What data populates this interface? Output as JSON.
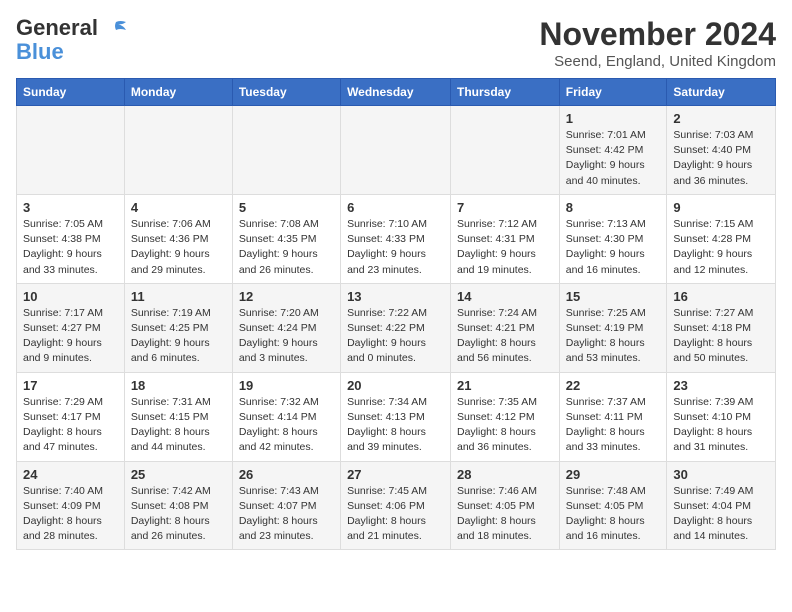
{
  "header": {
    "logo_line1": "General",
    "logo_line2": "Blue",
    "month_title": "November 2024",
    "location": "Seend, England, United Kingdom"
  },
  "days_of_week": [
    "Sunday",
    "Monday",
    "Tuesday",
    "Wednesday",
    "Thursday",
    "Friday",
    "Saturday"
  ],
  "weeks": [
    {
      "days": [
        {
          "number": "",
          "info": ""
        },
        {
          "number": "",
          "info": ""
        },
        {
          "number": "",
          "info": ""
        },
        {
          "number": "",
          "info": ""
        },
        {
          "number": "",
          "info": ""
        },
        {
          "number": "1",
          "info": "Sunrise: 7:01 AM\nSunset: 4:42 PM\nDaylight: 9 hours\nand 40 minutes."
        },
        {
          "number": "2",
          "info": "Sunrise: 7:03 AM\nSunset: 4:40 PM\nDaylight: 9 hours\nand 36 minutes."
        }
      ]
    },
    {
      "days": [
        {
          "number": "3",
          "info": "Sunrise: 7:05 AM\nSunset: 4:38 PM\nDaylight: 9 hours\nand 33 minutes."
        },
        {
          "number": "4",
          "info": "Sunrise: 7:06 AM\nSunset: 4:36 PM\nDaylight: 9 hours\nand 29 minutes."
        },
        {
          "number": "5",
          "info": "Sunrise: 7:08 AM\nSunset: 4:35 PM\nDaylight: 9 hours\nand 26 minutes."
        },
        {
          "number": "6",
          "info": "Sunrise: 7:10 AM\nSunset: 4:33 PM\nDaylight: 9 hours\nand 23 minutes."
        },
        {
          "number": "7",
          "info": "Sunrise: 7:12 AM\nSunset: 4:31 PM\nDaylight: 9 hours\nand 19 minutes."
        },
        {
          "number": "8",
          "info": "Sunrise: 7:13 AM\nSunset: 4:30 PM\nDaylight: 9 hours\nand 16 minutes."
        },
        {
          "number": "9",
          "info": "Sunrise: 7:15 AM\nSunset: 4:28 PM\nDaylight: 9 hours\nand 12 minutes."
        }
      ]
    },
    {
      "days": [
        {
          "number": "10",
          "info": "Sunrise: 7:17 AM\nSunset: 4:27 PM\nDaylight: 9 hours\nand 9 minutes."
        },
        {
          "number": "11",
          "info": "Sunrise: 7:19 AM\nSunset: 4:25 PM\nDaylight: 9 hours\nand 6 minutes."
        },
        {
          "number": "12",
          "info": "Sunrise: 7:20 AM\nSunset: 4:24 PM\nDaylight: 9 hours\nand 3 minutes."
        },
        {
          "number": "13",
          "info": "Sunrise: 7:22 AM\nSunset: 4:22 PM\nDaylight: 9 hours\nand 0 minutes."
        },
        {
          "number": "14",
          "info": "Sunrise: 7:24 AM\nSunset: 4:21 PM\nDaylight: 8 hours\nand 56 minutes."
        },
        {
          "number": "15",
          "info": "Sunrise: 7:25 AM\nSunset: 4:19 PM\nDaylight: 8 hours\nand 53 minutes."
        },
        {
          "number": "16",
          "info": "Sunrise: 7:27 AM\nSunset: 4:18 PM\nDaylight: 8 hours\nand 50 minutes."
        }
      ]
    },
    {
      "days": [
        {
          "number": "17",
          "info": "Sunrise: 7:29 AM\nSunset: 4:17 PM\nDaylight: 8 hours\nand 47 minutes."
        },
        {
          "number": "18",
          "info": "Sunrise: 7:31 AM\nSunset: 4:15 PM\nDaylight: 8 hours\nand 44 minutes."
        },
        {
          "number": "19",
          "info": "Sunrise: 7:32 AM\nSunset: 4:14 PM\nDaylight: 8 hours\nand 42 minutes."
        },
        {
          "number": "20",
          "info": "Sunrise: 7:34 AM\nSunset: 4:13 PM\nDaylight: 8 hours\nand 39 minutes."
        },
        {
          "number": "21",
          "info": "Sunrise: 7:35 AM\nSunset: 4:12 PM\nDaylight: 8 hours\nand 36 minutes."
        },
        {
          "number": "22",
          "info": "Sunrise: 7:37 AM\nSunset: 4:11 PM\nDaylight: 8 hours\nand 33 minutes."
        },
        {
          "number": "23",
          "info": "Sunrise: 7:39 AM\nSunset: 4:10 PM\nDaylight: 8 hours\nand 31 minutes."
        }
      ]
    },
    {
      "days": [
        {
          "number": "24",
          "info": "Sunrise: 7:40 AM\nSunset: 4:09 PM\nDaylight: 8 hours\nand 28 minutes."
        },
        {
          "number": "25",
          "info": "Sunrise: 7:42 AM\nSunset: 4:08 PM\nDaylight: 8 hours\nand 26 minutes."
        },
        {
          "number": "26",
          "info": "Sunrise: 7:43 AM\nSunset: 4:07 PM\nDaylight: 8 hours\nand 23 minutes."
        },
        {
          "number": "27",
          "info": "Sunrise: 7:45 AM\nSunset: 4:06 PM\nDaylight: 8 hours\nand 21 minutes."
        },
        {
          "number": "28",
          "info": "Sunrise: 7:46 AM\nSunset: 4:05 PM\nDaylight: 8 hours\nand 18 minutes."
        },
        {
          "number": "29",
          "info": "Sunrise: 7:48 AM\nSunset: 4:05 PM\nDaylight: 8 hours\nand 16 minutes."
        },
        {
          "number": "30",
          "info": "Sunrise: 7:49 AM\nSunset: 4:04 PM\nDaylight: 8 hours\nand 14 minutes."
        }
      ]
    }
  ]
}
